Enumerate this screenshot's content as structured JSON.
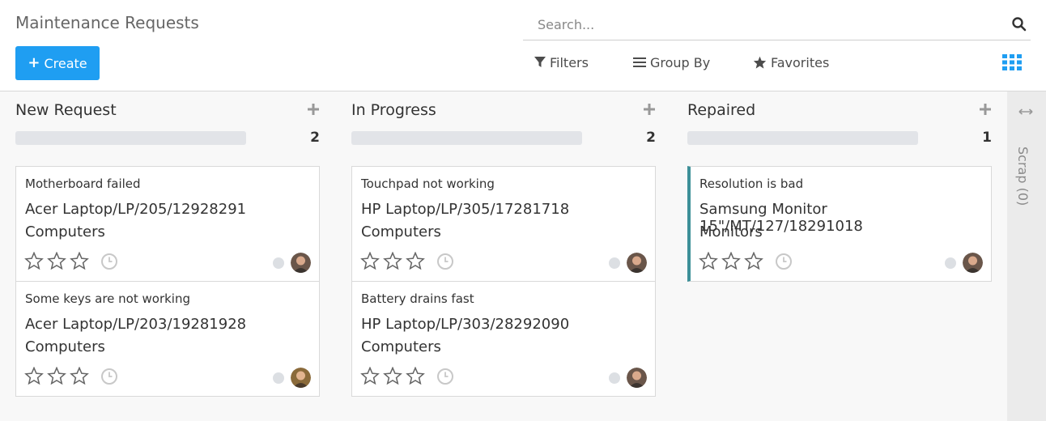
{
  "header": {
    "title": "Maintenance Requests",
    "create_label": "Create",
    "search_placeholder": "Search...",
    "filters_label": "Filters",
    "groupby_label": "Group By",
    "favorites_label": "Favorites"
  },
  "columns": [
    {
      "title": "New Request",
      "count": "2",
      "cards": [
        {
          "subject": "Motherboard failed",
          "equipment": "Acer Laptop/LP/205/12928291",
          "category": "Computers"
        },
        {
          "subject": "Some keys are not working",
          "equipment": "Acer Laptop/LP/203/19281928",
          "category": "Computers"
        }
      ]
    },
    {
      "title": "In Progress",
      "count": "2",
      "cards": [
        {
          "subject": "Touchpad not working",
          "equipment": "HP Laptop/LP/305/17281718",
          "category": "Computers"
        },
        {
          "subject": "Battery drains fast",
          "equipment": "HP Laptop/LP/303/28292090",
          "category": "Computers"
        }
      ]
    },
    {
      "title": "Repaired",
      "count": "1",
      "cards": [
        {
          "subject": "Resolution is bad",
          "equipment": "Samsung Monitor 15\"/MT/127/18291018",
          "category": "Monitors"
        }
      ]
    }
  ],
  "folded_column": {
    "label": "Scrap (0)"
  },
  "colors": {
    "primary": "#1f9ef2",
    "accent": "#3d9098"
  }
}
